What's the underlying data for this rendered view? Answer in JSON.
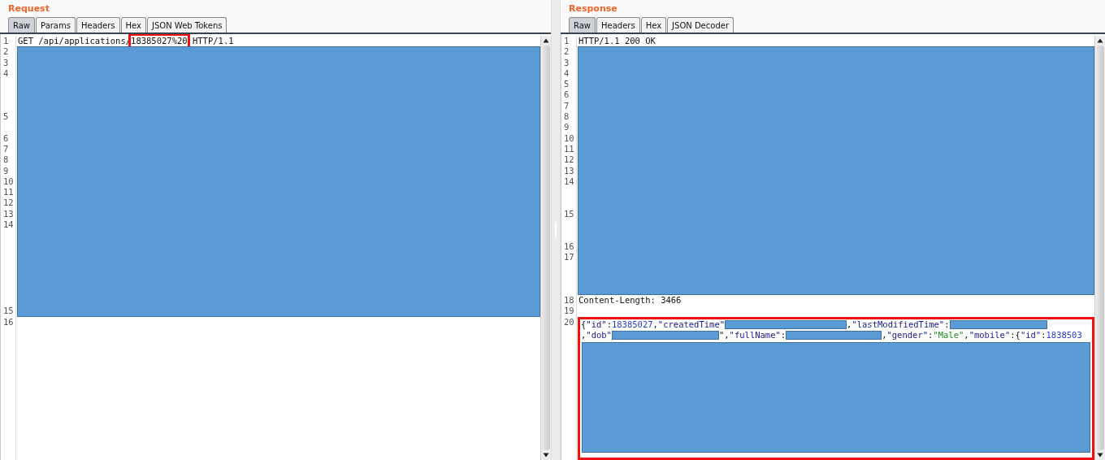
{
  "panels": [
    {
      "title": "Request",
      "tabs": [
        {
          "label": "Raw",
          "selected": true
        },
        {
          "label": "Params",
          "selected": false
        },
        {
          "label": "Headers",
          "selected": false
        },
        {
          "label": "Hex",
          "selected": false
        },
        {
          "label": "JSON Web Tokens",
          "selected": false
        }
      ],
      "blocks": [
        {
          "kind": "code",
          "lines": [
            "1"
          ],
          "rows": [
            {
              "segments": [
                {
                  "kind": "plain",
                  "text": "GET /api/applications/"
                },
                {
                  "kind": "highlight",
                  "text": "18385027%20"
                },
                {
                  "kind": "plain",
                  "text": " HTTP/1.1"
                }
              ]
            }
          ]
        },
        {
          "kind": "redacted",
          "lines": [
            "2",
            "3",
            "4",
            "5",
            "6",
            "7",
            "8",
            "9",
            "10",
            "11",
            "12",
            "13",
            "14",
            "15"
          ]
        },
        {
          "kind": "code",
          "lines": [
            "16"
          ]
        }
      ]
    },
    {
      "title": "Response",
      "tabs": [
        {
          "label": "Raw",
          "selected": true
        },
        {
          "label": "Headers",
          "selected": false
        },
        {
          "label": "Hex",
          "selected": false
        },
        {
          "label": "JSON Decoder",
          "selected": false
        }
      ],
      "blocks": [
        {
          "kind": "code",
          "lines": [
            "1"
          ],
          "rows": [
            {
              "segments": [
                {
                  "kind": "plain",
                  "text": "HTTP/1.1 200 OK"
                }
              ]
            }
          ]
        },
        {
          "kind": "redacted",
          "lines": [
            "2",
            "3",
            "4",
            "5",
            "6",
            "7",
            "8",
            "9",
            "10",
            "11",
            "12",
            "13",
            "14",
            "15",
            "16",
            "17"
          ]
        },
        {
          "kind": "code",
          "lines": [
            "18"
          ],
          "rows": [
            {
              "segments": [
                {
                  "kind": "plain",
                  "text": "Content-Length: 3466"
                }
              ]
            }
          ]
        },
        {
          "kind": "code",
          "lines": [
            "19"
          ]
        },
        {
          "kind": "framed",
          "lines": [
            "20"
          ],
          "tail_redacted": true,
          "rows": [
            {
              "segments": [
                {
                  "kind": "plain",
                  "text": "{"
                },
                {
                  "kind": "key",
                  "text": "\"id\""
                },
                {
                  "kind": "plain",
                  "text": ":"
                },
                {
                  "kind": "number",
                  "text": "18385027"
                },
                {
                  "kind": "plain",
                  "text": ","
                },
                {
                  "kind": "key",
                  "text": "\"createdTime\""
                },
                {
                  "kind": "redacted"
                },
                {
                  "kind": "plain",
                  "text": ","
                },
                {
                  "kind": "key",
                  "text": "\"lastModifiedTime\""
                },
                {
                  "kind": "plain",
                  "text": ":"
                },
                {
                  "kind": "redacted"
                }
              ]
            },
            {
              "segments": [
                {
                  "kind": "plain",
                  "text": ","
                },
                {
                  "kind": "key",
                  "text": "\"dob\""
                },
                {
                  "kind": "redacted"
                },
                {
                  "kind": "plain",
                  "text": "\","
                },
                {
                  "kind": "key",
                  "text": "\"fullName\""
                },
                {
                  "kind": "plain",
                  "text": ":"
                },
                {
                  "kind": "redacted"
                },
                {
                  "kind": "plain",
                  "text": ","
                },
                {
                  "kind": "key",
                  "text": "\"gender\""
                },
                {
                  "kind": "plain",
                  "text": ":"
                },
                {
                  "kind": "string",
                  "text": "\"Male\""
                },
                {
                  "kind": "plain",
                  "text": ","
                },
                {
                  "kind": "key",
                  "text": "\"mobile\""
                },
                {
                  "kind": "plain",
                  "text": ":{"
                },
                {
                  "kind": "key",
                  "text": "\"id\""
                },
                {
                  "kind": "plain",
                  "text": ":"
                },
                {
                  "kind": "number",
                  "text": "1838503"
                }
              ]
            }
          ]
        }
      ]
    }
  ]
}
